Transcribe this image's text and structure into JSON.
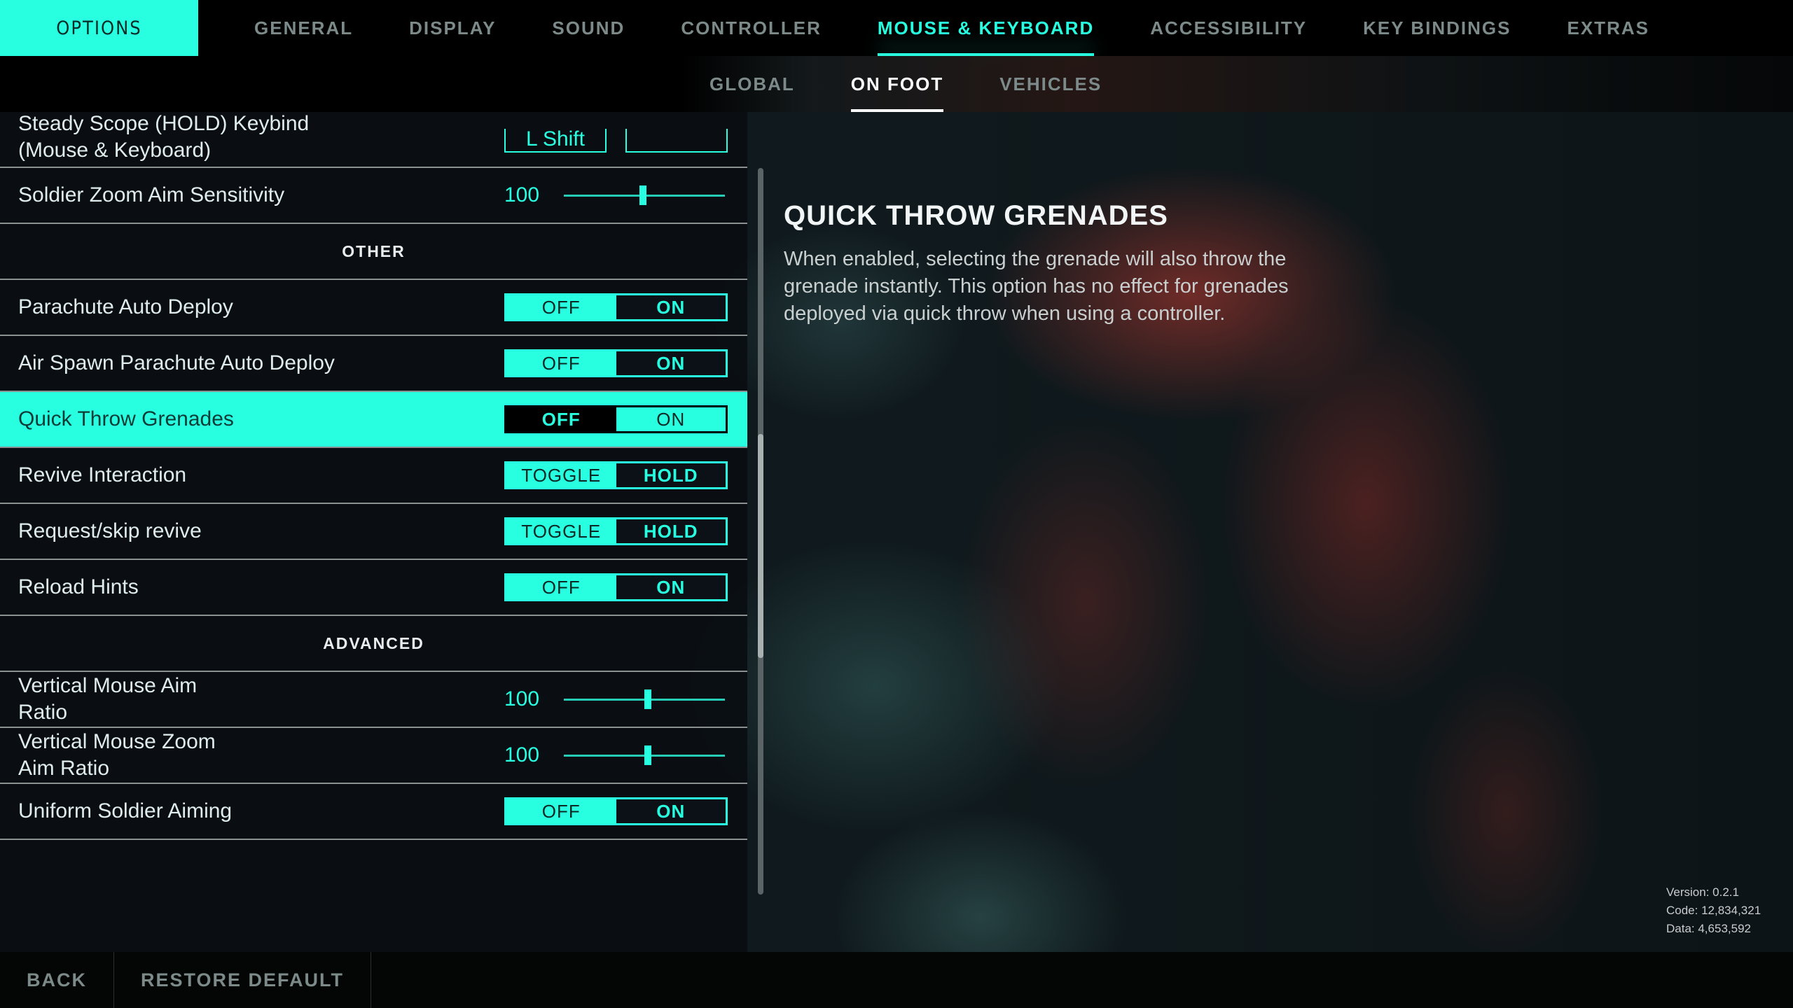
{
  "top_nav": {
    "title": "OPTIONS",
    "tabs": [
      {
        "label": "GENERAL"
      },
      {
        "label": "DISPLAY"
      },
      {
        "label": "SOUND"
      },
      {
        "label": "CONTROLLER"
      },
      {
        "label": "MOUSE & KEYBOARD",
        "active": true
      },
      {
        "label": "ACCESSIBILITY"
      },
      {
        "label": "KEY BINDINGS"
      },
      {
        "label": "EXTRAS"
      }
    ]
  },
  "sub_nav": {
    "tabs": [
      {
        "label": "GLOBAL"
      },
      {
        "label": "ON FOOT",
        "active": true
      },
      {
        "label": "VEHICLES"
      }
    ]
  },
  "settings": {
    "steady_scope": {
      "label": "Steady Scope (HOLD) Keybind (Mouse & Keyboard)",
      "primary_key": "L Shift",
      "secondary_key": ""
    },
    "soldier_zoom_aim": {
      "label": "Soldier Zoom Aim Sensitivity",
      "value": "100",
      "fraction": 0.49
    },
    "section_other": "OTHER",
    "parachute_auto_deploy": {
      "label": "Parachute Auto Deploy",
      "options": [
        "OFF",
        "ON"
      ],
      "selected": "ON"
    },
    "air_spawn_parachute": {
      "label": "Air Spawn Parachute Auto Deploy",
      "options": [
        "OFF",
        "ON"
      ],
      "selected": "ON"
    },
    "quick_throw_grenades": {
      "label": "Quick Throw Grenades",
      "options": [
        "OFF",
        "ON"
      ],
      "selected": "OFF",
      "focused": true
    },
    "revive_interaction": {
      "label": "Revive Interaction",
      "options": [
        "TOGGLE",
        "HOLD"
      ],
      "selected": "HOLD"
    },
    "request_skip_revive": {
      "label": "Request/skip revive",
      "options": [
        "TOGGLE",
        "HOLD"
      ],
      "selected": "HOLD"
    },
    "reload_hints": {
      "label": "Reload Hints",
      "options": [
        "OFF",
        "ON"
      ],
      "selected": "ON"
    },
    "section_advanced": "ADVANCED",
    "vertical_mouse_aim_ratio": {
      "label": "Vertical Mouse Aim Ratio",
      "value": "100",
      "fraction": 0.52
    },
    "vertical_mouse_zoom_aim_ratio": {
      "label": "Vertical Mouse Zoom Aim Ratio",
      "value": "100",
      "fraction": 0.52
    },
    "uniform_soldier_aiming": {
      "label": "Uniform Soldier Aiming",
      "options": [
        "OFF",
        "ON"
      ],
      "selected": "ON"
    }
  },
  "description": {
    "title": "QUICK THROW GRENADES",
    "body": "When enabled, selecting the grenade will also throw the grenade instantly. This option has no effect for grenades deployed via quick throw when using a controller."
  },
  "version_info": {
    "version": "Version: 0.2.1",
    "code": "Code: 12,834,321",
    "data": "Data: 4,653,592"
  },
  "bottom_bar": {
    "back": "BACK",
    "restore_default": "RESTORE DEFAULT"
  },
  "colors": {
    "accent": "#27ffe0",
    "panel_bg": "#0a0e12",
    "text_muted": "#7c8a8a"
  }
}
